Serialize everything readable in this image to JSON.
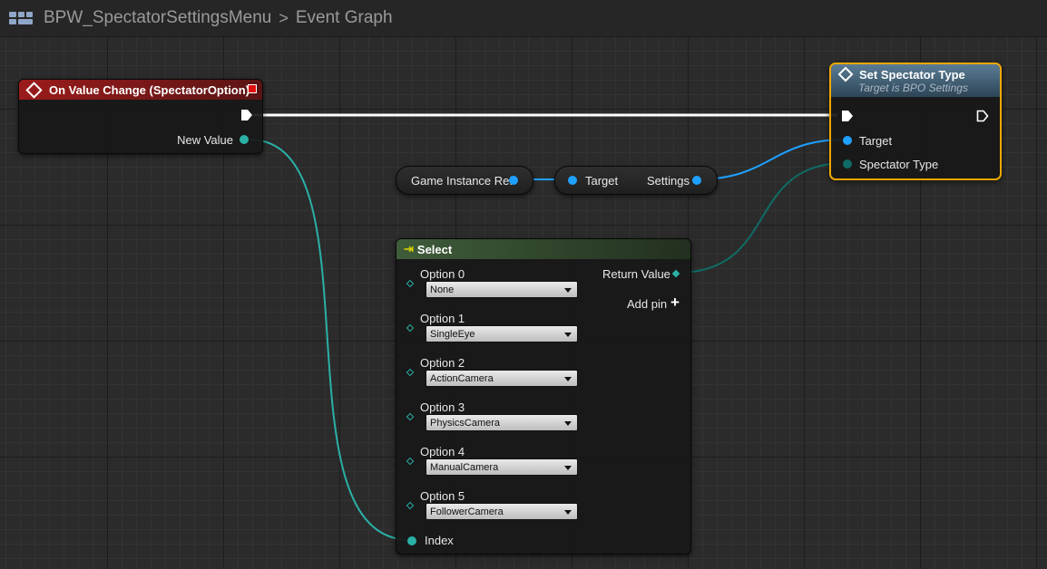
{
  "breadcrumb": {
    "blueprint_name": "BPW_SpectatorSettingsMenu",
    "separator": ">",
    "graph_name": "Event Graph"
  },
  "colors": {
    "exec": "#ffffff",
    "object_pin": "#1fa0ff",
    "enum_pin": "#0f6b66",
    "wildcard_pin": "#2ab0a6",
    "event_header": "#9b1b1b",
    "function_header": "#4a6a82",
    "select_header": "#3f5c3a",
    "selection_outline": "#f2a800"
  },
  "event_node": {
    "title": "On Value Change (SpectatorOption)",
    "output_pin_label": "New Value"
  },
  "set_node": {
    "title": "Set Spectator Type",
    "subtitle": "Target is BPO Settings",
    "pins": [
      "Target",
      "Spectator Type"
    ]
  },
  "game_instance_node": {
    "label": "Game Instance Ref"
  },
  "get_settings_node": {
    "input_label": "Target",
    "output_label": "Settings"
  },
  "select_node": {
    "title": "Select",
    "return_label": "Return Value",
    "add_pin_label": "Add pin",
    "index_label": "Index",
    "options": [
      {
        "label": "Option 0",
        "value": "None"
      },
      {
        "label": "Option 1",
        "value": "SingleEye"
      },
      {
        "label": "Option 2",
        "value": "ActionCamera"
      },
      {
        "label": "Option 3",
        "value": "PhysicsCamera"
      },
      {
        "label": "Option 4",
        "value": "ManualCamera"
      },
      {
        "label": "Option 5",
        "value": "FollowerCamera"
      }
    ]
  }
}
